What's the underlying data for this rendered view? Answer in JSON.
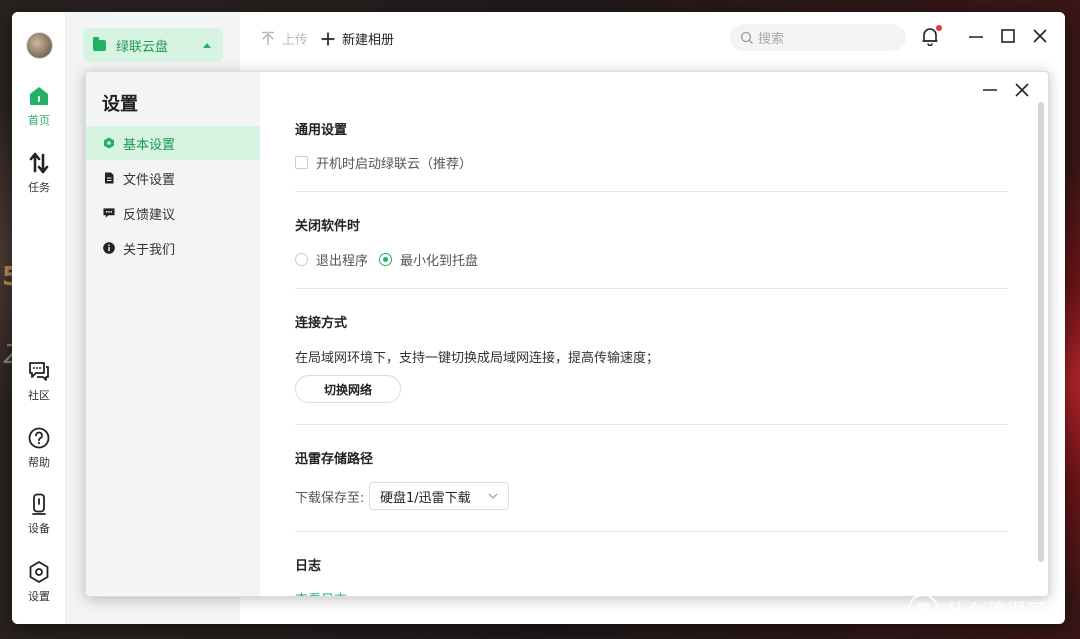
{
  "background": {
    "glyph_a": "5",
    "glyph_b": "Z"
  },
  "rail": {
    "items": [
      {
        "label": "首页",
        "icon": "home-icon",
        "active": true
      },
      {
        "label": "任务",
        "icon": "transfer-icon"
      },
      {
        "label": "社区",
        "icon": "chat-icon"
      },
      {
        "label": "帮助",
        "icon": "help-icon"
      },
      {
        "label": "设备",
        "icon": "device-icon"
      },
      {
        "label": "设置",
        "icon": "settings-icon"
      }
    ]
  },
  "drive": {
    "label": "绿联云盘"
  },
  "toolbar": {
    "upload_label": "上传",
    "new_album_label": "新建相册",
    "search_placeholder": "搜索"
  },
  "dialog": {
    "title": "设置",
    "nav": [
      {
        "label": "基本设置",
        "icon": "shield-icon",
        "active": true
      },
      {
        "label": "文件设置",
        "icon": "document-icon"
      },
      {
        "label": "反馈建议",
        "icon": "feedback-icon"
      },
      {
        "label": "关于我们",
        "icon": "info-icon"
      }
    ],
    "general": {
      "title": "通用设置",
      "autostart_label": "开机时启动绿联云（推荐）"
    },
    "close_behavior": {
      "title": "关闭软件时",
      "options": [
        "退出程序",
        "最小化到托盘"
      ],
      "selected": "最小化到托盘"
    },
    "connection": {
      "title": "连接方式",
      "description": "在局域网环境下，支持一键切换成局域网连接，提高传输速度；",
      "switch_label": "切换网络"
    },
    "thunder": {
      "title": "迅雷存储路径",
      "save_label": "下载保存至:",
      "path_value": "硬盘1/迅雷下载"
    },
    "log": {
      "title": "日志",
      "view_link": "查看日志"
    }
  },
  "watermark": {
    "text": "什么值得买",
    "logo": "值"
  },
  "colors": {
    "accent": "#22b266",
    "accent_bg": "#d7f3e2"
  }
}
